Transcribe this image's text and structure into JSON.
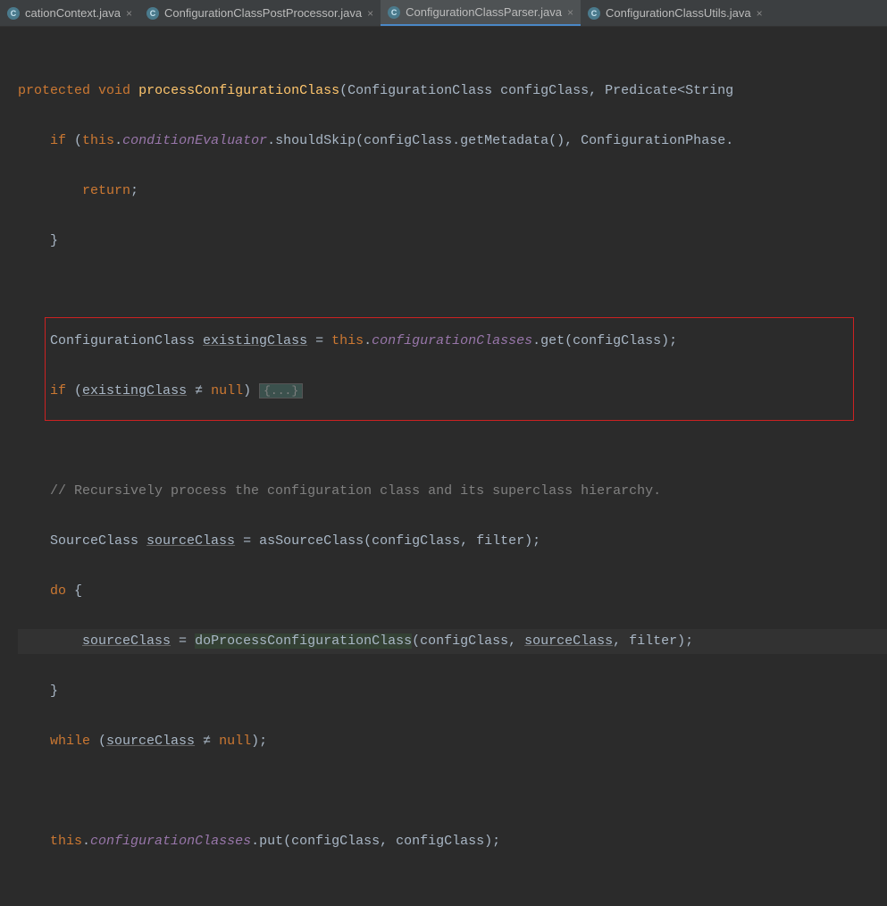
{
  "tabs": [
    {
      "label": "cationContext.java",
      "active": false
    },
    {
      "label": "ConfigurationClassPostProcessor.java",
      "active": false
    },
    {
      "label": "ConfigurationClassParser.java",
      "active": true
    },
    {
      "label": "ConfigurationClassUtils.java",
      "active": false
    }
  ],
  "code": {
    "l1_kw1": "protected",
    "l1_kw2": "void",
    "l1_method": "processConfigurationClass",
    "l1_rest": "(ConfigurationClass configClass, Predicate<String",
    "l2_if": "if",
    "l2_this": "this",
    "l2_field": "conditionEvaluator",
    "l2_rest": ".shouldSkip(configClass.getMetadata(), ConfigurationPhase.",
    "l3_return": "return",
    "l3_semi": ";",
    "l4_brace": "}",
    "l6_a": "ConfigurationClass ",
    "l6_var": "existingClass",
    "l6_b": " = ",
    "l6_this": "this",
    "l6_field": "configurationClasses",
    "l6_c": ".get(configClass);",
    "l7_if": "if",
    "l7_a": " (",
    "l7_var": "existingClass",
    "l7_ne": " ≠ ",
    "l7_null": "null",
    "l7_b": ") ",
    "l7_fold": "{...}",
    "l9_comment": "// Recursively process the configuration class and its superclass hierarchy.",
    "l10_a": "SourceClass ",
    "l10_var": "sourceClass",
    "l10_b": " = asSourceClass(configClass, filter);",
    "l11_do": "do",
    "l11_brace": " {",
    "l12_var1": "sourceClass",
    "l12_eq": " = ",
    "l12_call": "doProcessConfigurationClass",
    "l12_a": "(configClass, ",
    "l12_var2": "sourceClass",
    "l12_b": ", filter);",
    "l13_brace": "}",
    "l14_while": "while",
    "l14_a": " (",
    "l14_var": "sourceClass",
    "l14_ne": " ≠ ",
    "l14_null": "null",
    "l14_b": ");",
    "l16_this": "this",
    "l16_field": "configurationClasses",
    "l16_rest": ".put(configClass, configClass);"
  }
}
